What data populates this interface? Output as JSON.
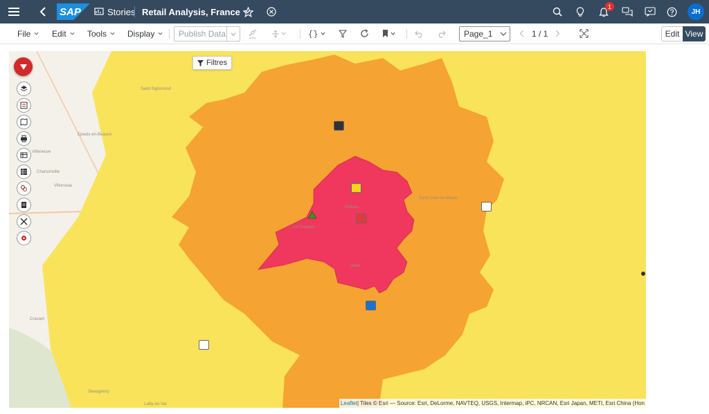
{
  "shell": {
    "logo_text": "SAP",
    "stories_label": "Stories",
    "story_title": "Retail Analysis, France",
    "notification_count": "1",
    "user_initials": "JH"
  },
  "toolbar": {
    "file_label": "File",
    "edit_label": "Edit",
    "tools_label": "Tools",
    "display_label": "Display",
    "publish_label": "Publish Data",
    "page_name": "Page_1",
    "page_counter": "1 / 1",
    "mode_edit": "Edit",
    "mode_view": "View"
  },
  "map": {
    "filter_label": "Filtres",
    "attribution_leaflet": "Leaflet",
    "attribution_text": " | Tiles © Esri — Source: Esri, DeLorme, NAVTEQ, USGS, Intermap, iPC, NRCAN, Esri Japan, METI, Esri China (Hon",
    "colors": {
      "outer_zone": "#f9e35b",
      "middle_zone": "#f5a332",
      "inner_zone": "#f0375d",
      "basemap": "#f4f1ea"
    },
    "place_labels": [
      "Saint-Sigismond",
      "Epieds-en-Beauce",
      "Villeneuve",
      "Charsonville",
      "Villorceau",
      "Cravant",
      "Beaugency",
      "Lailly-en-Val",
      "Orléans",
      "Saint-Jean-de-Braye",
      "La Chapelle",
      "Olivet"
    ]
  }
}
